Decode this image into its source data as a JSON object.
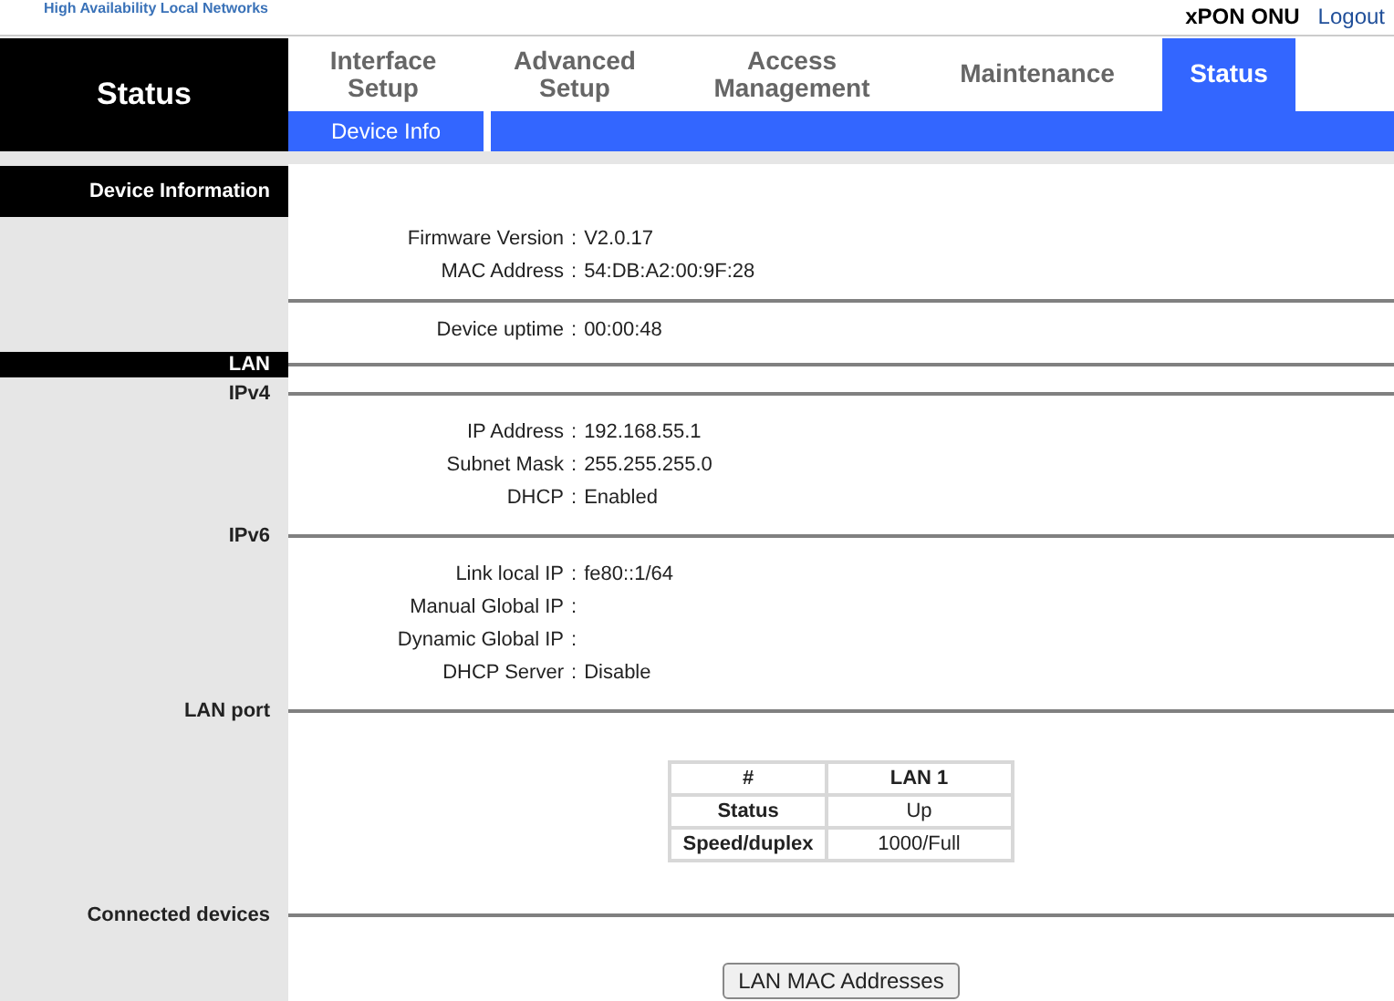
{
  "brand": "High Availability Local Networks",
  "top_links": {
    "device": "xPON ONU",
    "logout": "Logout"
  },
  "page_title": "Status",
  "tabs": [
    {
      "label": "Interface\nSetup",
      "selected": false
    },
    {
      "label": "Advanced\nSetup",
      "selected": false
    },
    {
      "label": "Access\nManagement",
      "selected": false
    },
    {
      "label": "Maintenance",
      "selected": false
    },
    {
      "label": "Status",
      "selected": true
    }
  ],
  "subtabs": [
    {
      "label": "Device Info"
    }
  ],
  "blocks": [
    {
      "kind": "heading",
      "label": "Device Information",
      "rule": false
    },
    {
      "kind": "fields",
      "fields": [
        {
          "label": "Firmware Version",
          "separator": ":",
          "value": "V2.0.17"
        },
        {
          "label": "MAC Address",
          "separator": ":",
          "value": "54:DB:A2:00:9F:28"
        }
      ]
    },
    {
      "kind": "divider"
    },
    {
      "kind": "fields",
      "fields": [
        {
          "label": "Device uptime",
          "separator": ":",
          "value": "00:00:48"
        }
      ]
    },
    {
      "kind": "heading",
      "label": "LAN",
      "rule": true
    },
    {
      "kind": "subheading",
      "label": "IPv4"
    },
    {
      "kind": "fields",
      "fields": [
        {
          "label": "IP Address",
          "separator": ":",
          "value": "192.168.55.1"
        },
        {
          "label": "Subnet Mask",
          "separator": ":",
          "value": "255.255.255.0"
        },
        {
          "label": "DHCP",
          "separator": ":",
          "value": "Enabled"
        }
      ]
    },
    {
      "kind": "subheading",
      "label": "IPv6"
    },
    {
      "kind": "fields",
      "fields": [
        {
          "label": "Link local IP",
          "separator": ":",
          "value": "fe80::1/64"
        },
        {
          "label": "Manual Global IP",
          "separator": ":"
        },
        {
          "label": "Dynamic Global IP",
          "separator": ":"
        },
        {
          "label": "DHCP Server",
          "separator": ":",
          "value": "Disable"
        }
      ]
    },
    {
      "kind": "subheading",
      "label": "LAN port"
    },
    {
      "kind": "table",
      "columns": [
        "#",
        "LAN 1"
      ],
      "rows": [
        [
          "Status",
          "Up"
        ],
        [
          "Speed/duplex",
          "1000/Full"
        ]
      ]
    },
    {
      "kind": "subheading",
      "label": "Connected devices"
    },
    {
      "kind": "button",
      "label": "LAN MAC Addresses"
    }
  ]
}
